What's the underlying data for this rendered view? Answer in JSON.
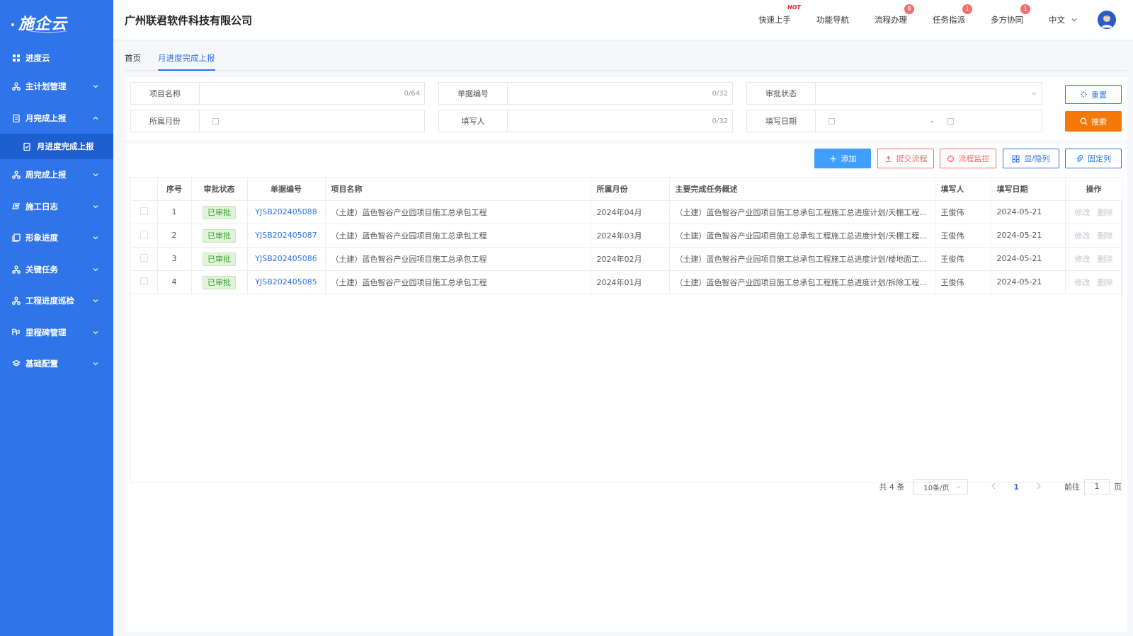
{
  "app": {
    "logo": "施企云"
  },
  "sidebar": {
    "top": {
      "label": "进度云"
    },
    "items": [
      {
        "label": "主计划管理",
        "icon": "org-icon",
        "expanded": false
      },
      {
        "label": "月完成上报",
        "icon": "clipboard-icon",
        "expanded": true
      },
      {
        "label": "周完成上报",
        "icon": "org-icon",
        "expanded": false
      },
      {
        "label": "施工日志",
        "icon": "log-icon",
        "expanded": false
      },
      {
        "label": "形象进度",
        "icon": "stack-icon",
        "expanded": false
      },
      {
        "label": "关键任务",
        "icon": "org-icon",
        "expanded": false
      },
      {
        "label": "工程进度巡检",
        "icon": "org-icon",
        "expanded": false
      },
      {
        "label": "里程碑管理",
        "icon": "milestone-icon",
        "expanded": false
      },
      {
        "label": "基础配置",
        "icon": "layers-icon",
        "expanded": false
      }
    ],
    "sub_item": {
      "label": "月进度完成上报"
    }
  },
  "header": {
    "company": "广州联君软件科技有限公司",
    "links": [
      {
        "label": "快速上手",
        "badge": "HOT"
      },
      {
        "label": "功能导航",
        "badge": ""
      },
      {
        "label": "流程办理",
        "badge": "8"
      },
      {
        "label": "任务指派",
        "badge": "1"
      },
      {
        "label": "多方协同",
        "badge": "1"
      }
    ],
    "language": "中文"
  },
  "tabs": [
    {
      "label": "首页",
      "active": false
    },
    {
      "label": "月进度完成上报",
      "active": true
    }
  ],
  "filters": {
    "project_name": {
      "label": "项目名称",
      "value": "",
      "count": "0/64"
    },
    "doc_no": {
      "label": "单据编号",
      "value": "",
      "count": "0/32"
    },
    "status": {
      "label": "审批状态",
      "value": ""
    },
    "month": {
      "label": "所属月份",
      "value": ""
    },
    "filler": {
      "label": "填写人",
      "value": "",
      "count": "0/32"
    },
    "date": {
      "label": "填写日期",
      "separator": "-"
    },
    "reset_label": "重置",
    "search_label": "搜索"
  },
  "toolbar": {
    "add": "添加",
    "submit": "提交流程",
    "monitor": "流程监控",
    "columns": "显/隐列",
    "fix": "固定列"
  },
  "table": {
    "headers": [
      "",
      "序号",
      "审批状态",
      "单据编号",
      "项目名称",
      "所属月份",
      "主要完成任务概述",
      "填写人",
      "填写日期",
      "操作"
    ],
    "rows": [
      {
        "no": "1",
        "status": "已审批",
        "doc": "YJSB202405088",
        "project": "（土建）蓝色智谷产业园项目施工总承包工程",
        "month": "2024年04月",
        "summary": "（土建）蓝色智谷产业园项目施工总承包工程施工总进度计划/天棚工程...",
        "filler": "王俊伟",
        "date": "2024-05-21"
      },
      {
        "no": "2",
        "status": "已审批",
        "doc": "YJSB202405087",
        "project": "（土建）蓝色智谷产业园项目施工总承包工程",
        "month": "2024年03月",
        "summary": "（土建）蓝色智谷产业园项目施工总承包工程施工总进度计划/天棚工程...",
        "filler": "王俊伟",
        "date": "2024-05-21"
      },
      {
        "no": "3",
        "status": "已审批",
        "doc": "YJSB202405086",
        "project": "（土建）蓝色智谷产业园项目施工总承包工程",
        "month": "2024年02月",
        "summary": "（土建）蓝色智谷产业园项目施工总承包工程施工总进度计划/楼地面工...",
        "filler": "王俊伟",
        "date": "2024-05-21"
      },
      {
        "no": "4",
        "status": "已审批",
        "doc": "YJSB202405085",
        "project": "（土建）蓝色智谷产业园项目施工总承包工程",
        "month": "2024年01月",
        "summary": "（土建）蓝色智谷产业园项目施工总承包工程施工总进度计划/拆除工程...",
        "filler": "王俊伟",
        "date": "2024-05-21"
      }
    ],
    "op_edit": "修改",
    "op_delete": "删除"
  },
  "pager": {
    "total": "共 4 条",
    "page_size": "10条/页",
    "current": "1",
    "goto_prefix": "前往",
    "goto_value": "1",
    "goto_suffix": "页"
  },
  "colors": {
    "primary": "#2f74e8",
    "search": "#f5780a",
    "danger": "#f56c6c",
    "success_bg": "#e1f3d8"
  }
}
